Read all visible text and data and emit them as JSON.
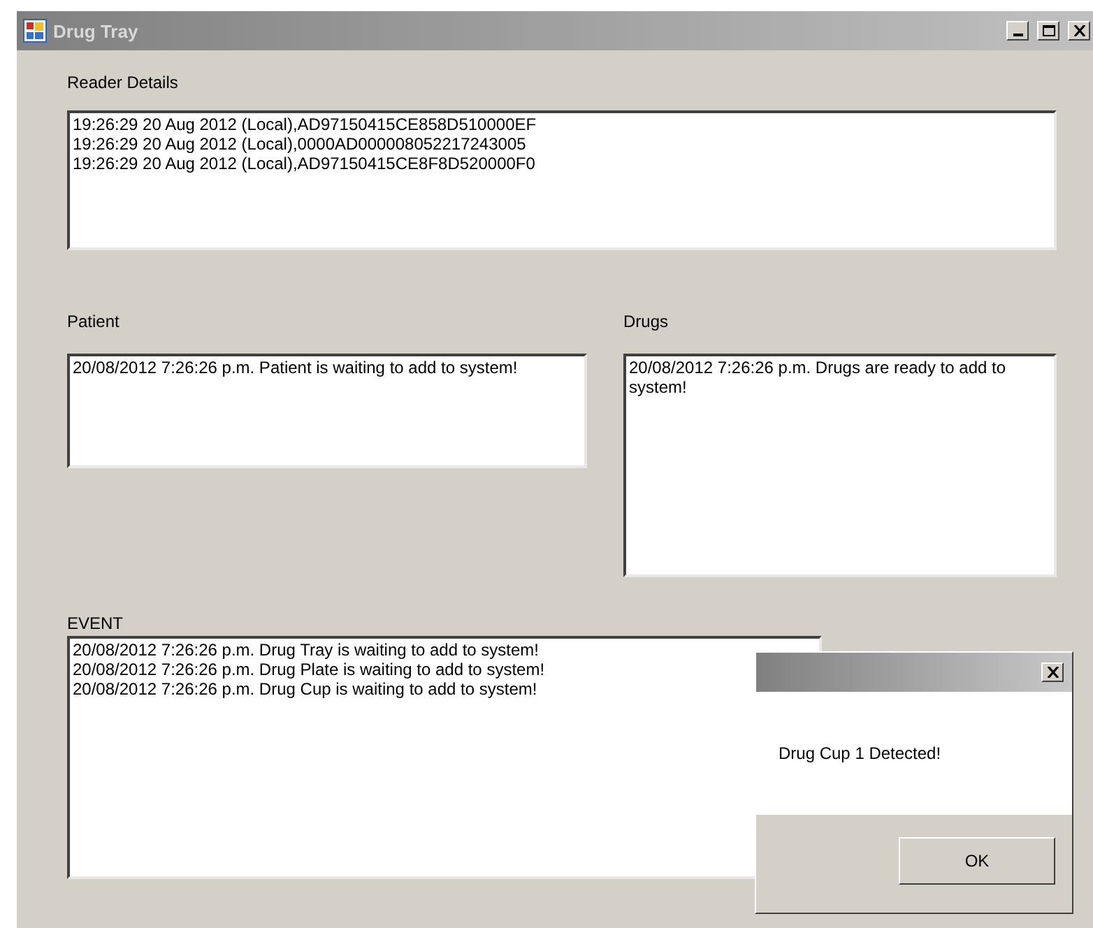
{
  "window": {
    "title": "Drug Tray"
  },
  "reader": {
    "label": "Reader Details",
    "lines": [
      "19:26:29 20 Aug 2012 (Local),AD97150415CE858D510000EF",
      "19:26:29 20 Aug 2012 (Local),0000AD000008052217243005",
      "19:26:29 20 Aug 2012 (Local),AD97150415CE8F8D520000F0"
    ]
  },
  "patient": {
    "label": "Patient",
    "text": "20/08/2012 7:26:26 p.m. Patient is waiting to add to system!"
  },
  "drugs": {
    "label": "Drugs",
    "text": "20/08/2012 7:26:26 p.m. Drugs are ready to add to system!"
  },
  "event": {
    "label": "EVENT",
    "lines": [
      "20/08/2012 7:26:26 p.m. Drug Tray is waiting to add to system!",
      "20/08/2012 7:26:26 p.m. Drug Plate is waiting to add to system!",
      "20/08/2012 7:26:26 p.m. Drug Cup is waiting to add to system!"
    ]
  },
  "dialog": {
    "message": "Drug Cup 1 Detected!",
    "button": "OK"
  }
}
